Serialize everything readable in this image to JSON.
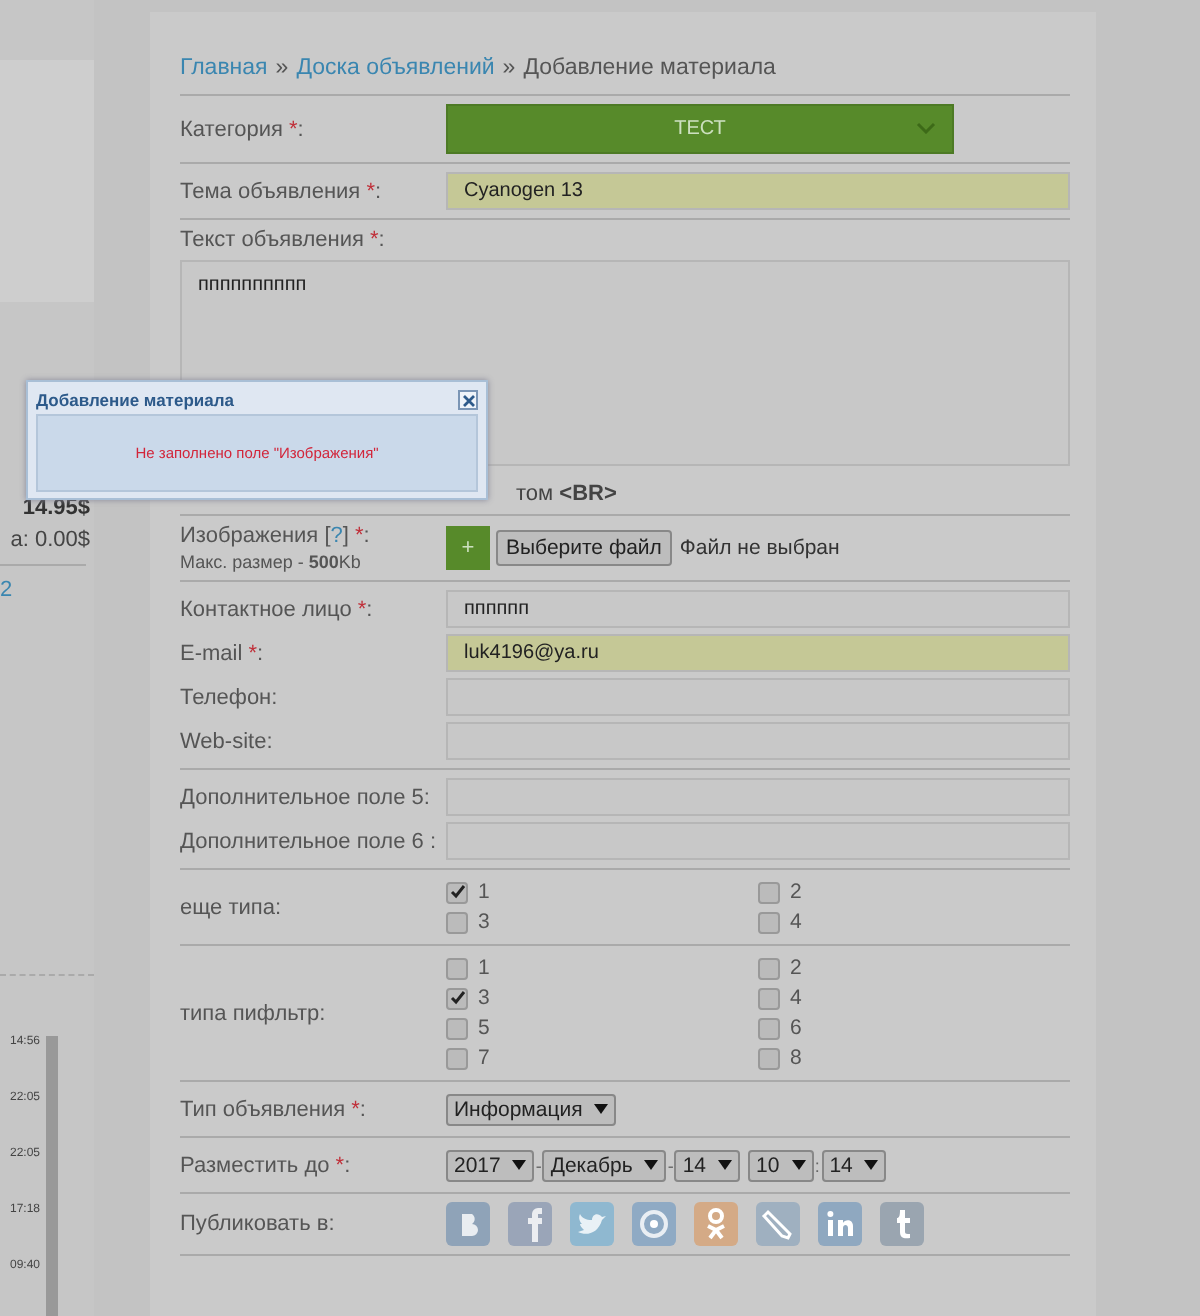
{
  "sidebar": {
    "price": "14.95$",
    "balance": "а: 0.00$",
    "link": "2",
    "times": [
      "14:56",
      "22:05",
      "22:05",
      "17:18",
      "09:40"
    ]
  },
  "breadcrumb": {
    "separator": "»",
    "items": [
      {
        "text": "Главная",
        "kind": "link"
      },
      {
        "text": "Доска объявлений",
        "kind": "link"
      },
      {
        "text": "Добавление материала",
        "kind": "current"
      }
    ]
  },
  "groups": [
    {
      "rows": [
        {
          "kind": "select",
          "label": [
            {
              "text": "Категория "
            },
            {
              "text": "*",
              "kind": "star"
            },
            {
              "text": ":"
            }
          ],
          "value": "ТЕСТ"
        }
      ]
    },
    {
      "rows": [
        {
          "kind": "text",
          "label": [
            {
              "text": "Тема объявления "
            },
            {
              "text": "*",
              "kind": "star"
            },
            {
              "text": ":"
            }
          ],
          "value": "Cyanogen 13",
          "highlighted": true
        }
      ]
    },
    {
      "rows": [
        {
          "kind": "textarea",
          "label": [
            {
              "text": "Текст объявления "
            },
            {
              "text": "*",
              "kind": "star"
            },
            {
              "text": ":"
            }
          ],
          "value": "пппппппппп",
          "note": "том **<BR>**"
        }
      ]
    },
    {
      "rows": [
        {
          "kind": "file",
          "label": [
            {
              "text": "Изображения ["
            },
            {
              "text": "?",
              "kind": "link"
            },
            {
              "text": "] "
            },
            {
              "text": "*",
              "kind": "star"
            },
            {
              "text": ":"
            }
          ],
          "hint": "Макс. размер - **500**Kb",
          "add": "+",
          "button": "Выберите файл",
          "status": "Файл не выбран"
        }
      ]
    },
    {
      "rows": [
        {
          "kind": "text",
          "label": [
            {
              "text": "Контактное лицо "
            },
            {
              "text": "*",
              "kind": "star"
            },
            {
              "text": ":"
            }
          ],
          "value": "пппппп",
          "highlighted": false
        },
        {
          "kind": "text",
          "label": [
            {
              "text": "E-mail "
            },
            {
              "text": "*",
              "kind": "star"
            },
            {
              "text": ":"
            }
          ],
          "value": "luk4196@ya.ru",
          "highlighted": true
        },
        {
          "kind": "text",
          "label": [
            {
              "text": "Телефон:"
            }
          ],
          "highlighted": false
        },
        {
          "kind": "text",
          "label": [
            {
              "text": "Web-site:"
            }
          ],
          "highlighted": false
        }
      ]
    },
    {
      "rows": [
        {
          "kind": "text",
          "label": [
            {
              "text": "Дополнительное поле 5:"
            }
          ],
          "highlighted": false
        },
        {
          "kind": "text",
          "label": [
            {
              "text": "Дополнительное поле 6 :"
            }
          ],
          "highlighted": false
        }
      ]
    },
    {
      "rows": [
        {
          "kind": "checkboxes",
          "label": [
            {
              "text": "еще типа:"
            }
          ],
          "options": [
            {
              "label": "1",
              "checked": true
            },
            {
              "label": "2",
              "checked": false
            },
            {
              "label": "3",
              "checked": false
            },
            {
              "label": "4",
              "checked": false
            }
          ]
        }
      ]
    },
    {
      "rows": [
        {
          "kind": "checkboxes",
          "label": [
            {
              "text": "типа пифльтр:"
            }
          ],
          "options": [
            {
              "label": "1",
              "checked": false
            },
            {
              "label": "2",
              "checked": false
            },
            {
              "label": "3",
              "checked": true
            },
            {
              "label": "4",
              "checked": false
            },
            {
              "label": "5",
              "checked": false
            },
            {
              "label": "6",
              "checked": false
            },
            {
              "label": "7",
              "checked": false
            },
            {
              "label": "8",
              "checked": false
            }
          ]
        }
      ]
    },
    {
      "rows": [
        {
          "kind": "dropdowns",
          "label": [
            {
              "text": "Тип объявления "
            },
            {
              "text": "*",
              "kind": "star"
            },
            {
              "text": ":"
            }
          ],
          "dropdowns": [
            {
              "value": "Информация"
            }
          ]
        }
      ]
    },
    {
      "rows": [
        {
          "kind": "dropdowns",
          "label": [
            {
              "text": "Разместить до "
            },
            {
              "text": "*",
              "kind": "star"
            },
            {
              "text": ":"
            }
          ],
          "dropdowns": [
            {
              "value": "2017"
            },
            {
              "value": "Декабрь",
              "sep": "-"
            },
            {
              "value": "14",
              "sep": "-"
            },
            {
              "value": "10"
            },
            {
              "value": "14",
              "sep": ":"
            }
          ]
        }
      ]
    },
    {
      "rows": [
        {
          "kind": "social",
          "label": [
            {
              "text": "Публиковать в:"
            }
          ],
          "networks": [
            {
              "kind": "vk",
              "color": "#8fa3b8"
            },
            {
              "kind": "facebook",
              "color": "#9aa5b8"
            },
            {
              "kind": "twitter",
              "color": "#8fb8d0"
            },
            {
              "kind": "mail",
              "color": "#8faac4"
            },
            {
              "kind": "ok",
              "color": "#d4aa86"
            },
            {
              "kind": "livejournal",
              "color": "#9fb0c0"
            },
            {
              "kind": "linkedin",
              "color": "#8fa8c0"
            },
            {
              "kind": "tumblr",
              "color": "#9aa5b0"
            }
          ]
        }
      ]
    }
  ],
  "dialog": {
    "title": "Добавление материала",
    "message": "Не заполнено поле \"Изображения\""
  }
}
